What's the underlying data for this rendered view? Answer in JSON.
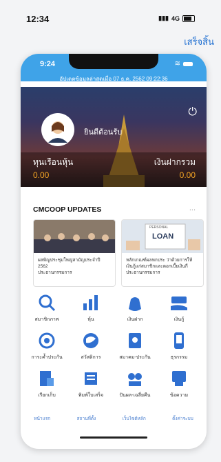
{
  "os": {
    "time": "12:34",
    "carrier": "4G",
    "done_label": "เสร็จสิ้น"
  },
  "phone": {
    "time": "9:24",
    "updated_text": "อัปเดตข้อมูลล่าสุดเมื่อ 07 ธ.ค. 2562 09:22:36",
    "welcome": "ยินดีต้อนรับ",
    "share_label": "ทุนเรือนหุ้น",
    "share_value": "0.00",
    "deposit_label": "เงินฝากรวม",
    "deposit_value": "0.00",
    "updates_title": "CMCOOP UPDATES",
    "more": "...",
    "cards": [
      {
        "caption": "ผลพิญประชุมใหญ่สามัญประจำปี 2562\nประธานกรรมการ"
      },
      {
        "caption": "หลักเกณฑ์ผลหกประ ว่าด้วยการให้เงินกู้แก่สมาชิกและดอกเบี้ยเงินกี\nประธานกรรมการ",
        "badge": "PERSONAL",
        "loan": "LOAN"
      }
    ],
    "menu": [
      {
        "label": "สมาชิกภาพ",
        "icon": "search-member-icon"
      },
      {
        "label": "หุ้น",
        "icon": "stock-chart-icon"
      },
      {
        "label": "เงินฝาก",
        "icon": "money-bag-icon"
      },
      {
        "label": "เงินกู้",
        "icon": "loan-hand-icon"
      },
      {
        "label": "การะค้ำประกัน",
        "icon": "guarantee-icon"
      },
      {
        "label": "สวัสดิการ",
        "icon": "welfare-globe-icon"
      },
      {
        "label": "สมาคม-ประกัน",
        "icon": "insurance-icon"
      },
      {
        "label": "ธุรกรรม",
        "icon": "transaction-phone-icon"
      },
      {
        "label": "เรียกเก็บ",
        "icon": "billing-icon"
      },
      {
        "label": "พิมพ์ใบเสร็จ",
        "icon": "receipt-printer-icon"
      },
      {
        "label": "ปันผล-เฉลี่ยคืน",
        "icon": "dividend-icon"
      },
      {
        "label": "ข้อความ",
        "icon": "message-icon"
      }
    ],
    "tabs": [
      "หน้าแรก",
      "สถานที่ตั้ง",
      "เว็บไซต์หลัก",
      "ตั้งค่าระบบ"
    ]
  },
  "colors": {
    "accent": "#3fa3e8",
    "icon_blue": "#2f6fd0",
    "highlight": "#f5a524"
  }
}
